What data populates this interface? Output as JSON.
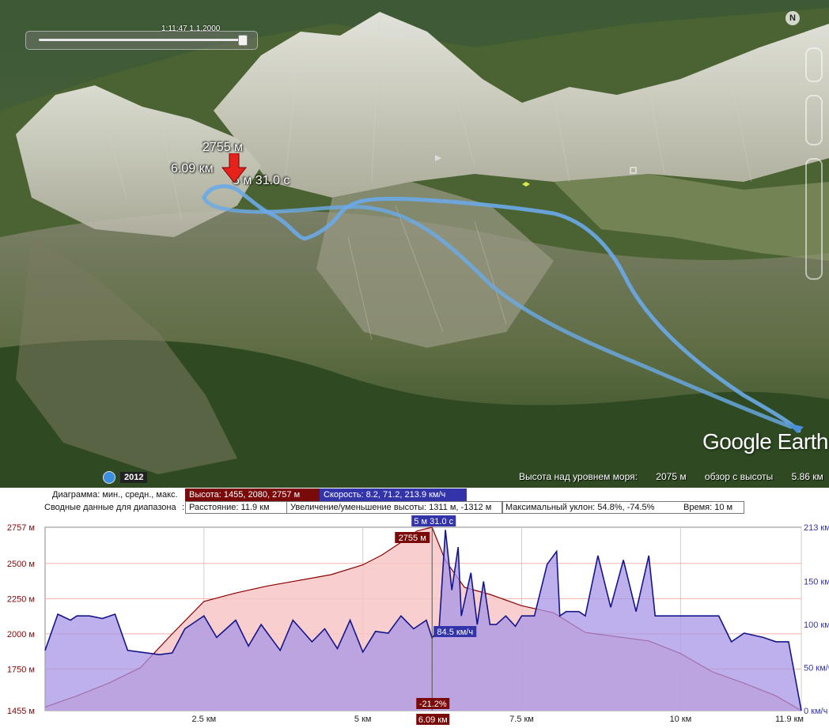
{
  "map": {
    "time_slider_label": "1:11:47 1.1.2000",
    "compass_label": "N",
    "marker": {
      "elevation": "2755 м",
      "distance": "6.09 км",
      "time": "5 м 31.0 с"
    },
    "logo": "Google Earth",
    "year": "2012",
    "status": {
      "elevation_label": "Высота над уровнем моря:",
      "elevation_value": "2075 м",
      "eye_label": "обзор с высоты",
      "eye_value": "5.86 км"
    },
    "colors": {
      "track": "#6aaae8",
      "marker": "#e5231b"
    }
  },
  "profile": {
    "diagram_label": "Диаграмма: мин., средн., макс.",
    "elevation_stats": "Высота: 1455, 2080, 2757 м",
    "speed_stats": "Скорость: 8.2, 71.2, 213.9 км/ч",
    "summary_label": "Сводные данные для диапазона",
    "distance": "Расстояние: 11.9 км",
    "gain_loss": "Увеличение/уменьшение высоты: 1311 м, -1312 м",
    "max_slope": "Максимальный уклон: 54.8%, -74.5%",
    "time": "Время: 10 м",
    "cursor": {
      "time": "5 м 31.0 с",
      "elevation": "2755 м",
      "speed": "84.5 км/ч",
      "slope": "-21.2%",
      "distance": "6.09 км"
    },
    "colors": {
      "elevation_line": "#8b0000",
      "elevation_fill": "#f7c6c6",
      "speed_line": "#15158a",
      "speed_fill": "#a896e6",
      "elev_tag": "#7a0a0a",
      "speed_tag": "#3333aa"
    }
  },
  "chart_data": {
    "type": "area",
    "xlabel": "",
    "xlim": [
      0,
      11.9
    ],
    "x_ticks": [
      2.5,
      5,
      7.5,
      10,
      11.9
    ],
    "x_tick_labels": [
      "2.5 км",
      "5 км",
      "7.5 км",
      "10 км",
      "11.9 км"
    ],
    "y_left_ticks": [
      1455,
      1750,
      2000,
      2250,
      2500,
      2757
    ],
    "y_left_tick_labels": [
      "1455 м",
      "1750 м",
      "2000 м",
      "2250 м",
      "2500 м",
      "2757 м"
    ],
    "y_right_ticks": [
      0,
      50,
      100,
      150,
      213
    ],
    "y_right_tick_labels": [
      "0 км/ч",
      "50 км/ч",
      "100 км/ч",
      "150 км/ч",
      "213 км/ч"
    ],
    "grid": true,
    "series": [
      {
        "name": "Высота",
        "axis": "left",
        "x": [
          0,
          0.5,
          1.0,
          1.5,
          2.0,
          2.5,
          3.0,
          3.5,
          4.0,
          4.5,
          5.0,
          5.3,
          5.6,
          5.85,
          6.09,
          6.3,
          6.6,
          7.0,
          7.5,
          8.0,
          8.5,
          9.0,
          9.5,
          10.0,
          10.5,
          11.0,
          11.5,
          11.9
        ],
        "values": [
          1480,
          1560,
          1650,
          1760,
          2000,
          2230,
          2290,
          2340,
          2380,
          2420,
          2490,
          2560,
          2650,
          2730,
          2757,
          2520,
          2330,
          2280,
          2200,
          2150,
          2010,
          1980,
          1950,
          1860,
          1730,
          1650,
          1560,
          1455
        ]
      },
      {
        "name": "Скорость",
        "axis": "right",
        "x": [
          0,
          0.2,
          0.4,
          0.5,
          0.7,
          0.9,
          1.1,
          1.3,
          1.5,
          1.8,
          2.0,
          2.2,
          2.5,
          2.7,
          3.0,
          3.2,
          3.4,
          3.7,
          3.9,
          4.2,
          4.4,
          4.6,
          4.8,
          5.0,
          5.2,
          5.4,
          5.6,
          5.8,
          6.0,
          6.09,
          6.2,
          6.3,
          6.4,
          6.5,
          6.55,
          6.7,
          6.8,
          6.9,
          7.0,
          7.1,
          7.25,
          7.4,
          7.5,
          7.7,
          7.9,
          8.05,
          8.1,
          8.2,
          8.4,
          8.5,
          8.7,
          8.9,
          9.1,
          9.3,
          9.5,
          9.6,
          9.8,
          10.0,
          10.2,
          10.4,
          10.6,
          10.8,
          11.0,
          11.3,
          11.5,
          11.7,
          11.9
        ],
        "values": [
          70,
          112,
          105,
          110,
          110,
          107,
          112,
          70,
          68,
          65,
          67,
          95,
          110,
          85,
          105,
          75,
          100,
          70,
          105,
          80,
          95,
          72,
          105,
          68,
          92,
          90,
          110,
          95,
          105,
          84.5,
          95,
          210,
          140,
          190,
          110,
          160,
          100,
          150,
          100,
          100,
          110,
          98,
          110,
          110,
          170,
          185,
          110,
          115,
          115,
          110,
          180,
          120,
          175,
          115,
          180,
          110,
          110,
          110,
          110,
          110,
          110,
          80,
          90,
          85,
          80,
          80,
          0
        ]
      }
    ]
  }
}
